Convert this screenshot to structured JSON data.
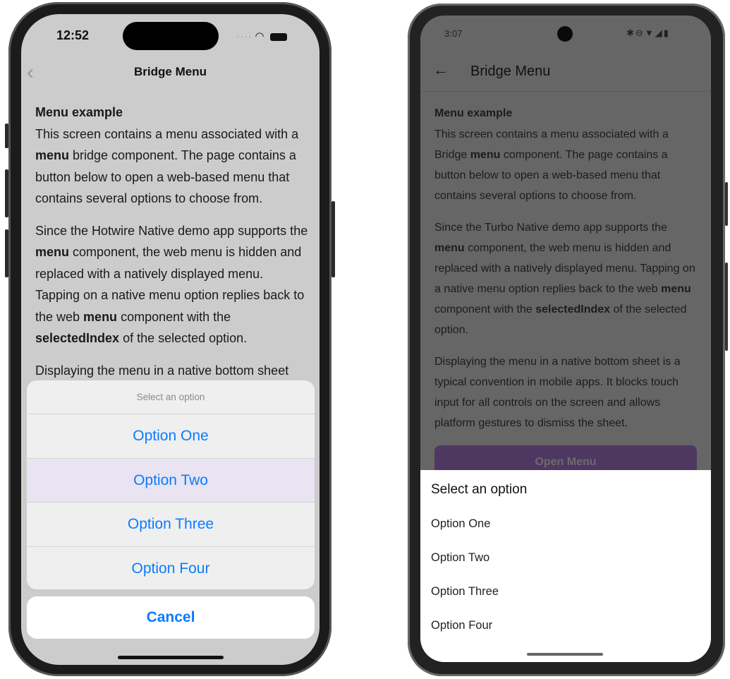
{
  "ios": {
    "status_time": "12:52",
    "status_icons": [
      "signal-dots-icon",
      "wifi-icon",
      "battery-icon"
    ],
    "nav_title": "Bridge Menu",
    "heading": "Menu example",
    "paragraphs": [
      [
        {
          "t": "This screen contains a menu associated with a "
        },
        {
          "t": "menu",
          "b": true
        },
        {
          "t": " bridge component. The page contains a button below to open a web-based menu that contains several options to choose from."
        }
      ],
      [
        {
          "t": "Since the Hotwire Native demo app supports the "
        },
        {
          "t": "menu",
          "b": true
        },
        {
          "t": " component, the web menu is hidden and replaced with a natively displayed menu. Tapping on a native menu option replies back to the web "
        },
        {
          "t": "menu",
          "b": true
        },
        {
          "t": " component with the "
        },
        {
          "t": "selectedIndex",
          "b": true
        },
        {
          "t": " of the selected option."
        }
      ],
      [
        {
          "t": "Displaying the menu in a native bottom sheet"
        }
      ]
    ],
    "sheet": {
      "title": "Select an option",
      "options": [
        "Option One",
        "Option Two",
        "Option Three",
        "Option Four"
      ],
      "cancel": "Cancel"
    },
    "accent": "#0a7cff"
  },
  "android": {
    "status_time": "3:07",
    "status_icons": [
      "bluetooth-icon",
      "do-not-disturb-icon",
      "wifi-icon",
      "signal-icon",
      "battery-icon"
    ],
    "nav_title": "Bridge Menu",
    "heading": "Menu example",
    "paragraphs": [
      [
        {
          "t": "This screen contains a menu associated with a Bridge "
        },
        {
          "t": "menu",
          "b": true
        },
        {
          "t": " component. The page contains a button below to open a web-based menu that contains several options to choose from."
        }
      ],
      [
        {
          "t": "Since the Turbo Native demo app supports the "
        },
        {
          "t": "menu",
          "b": true
        },
        {
          "t": " component, the web menu is hidden and replaced with a natively displayed menu. Tapping on a native menu option replies back to the web "
        },
        {
          "t": "menu",
          "b": true
        },
        {
          "t": " component with the "
        },
        {
          "t": "selectedIndex",
          "b": true
        },
        {
          "t": " of the selected option."
        }
      ],
      [
        {
          "t": "Displaying the menu in a native bottom sheet is a typical convention in mobile apps. It blocks touch input for all controls on the screen and allows platform gestures to dismiss the sheet."
        }
      ]
    ],
    "open_menu_button": "Open Menu",
    "sheet": {
      "title": "Select an option",
      "options": [
        "Option One",
        "Option Two",
        "Option Three",
        "Option Four"
      ]
    },
    "button_color": "#4e3862"
  }
}
